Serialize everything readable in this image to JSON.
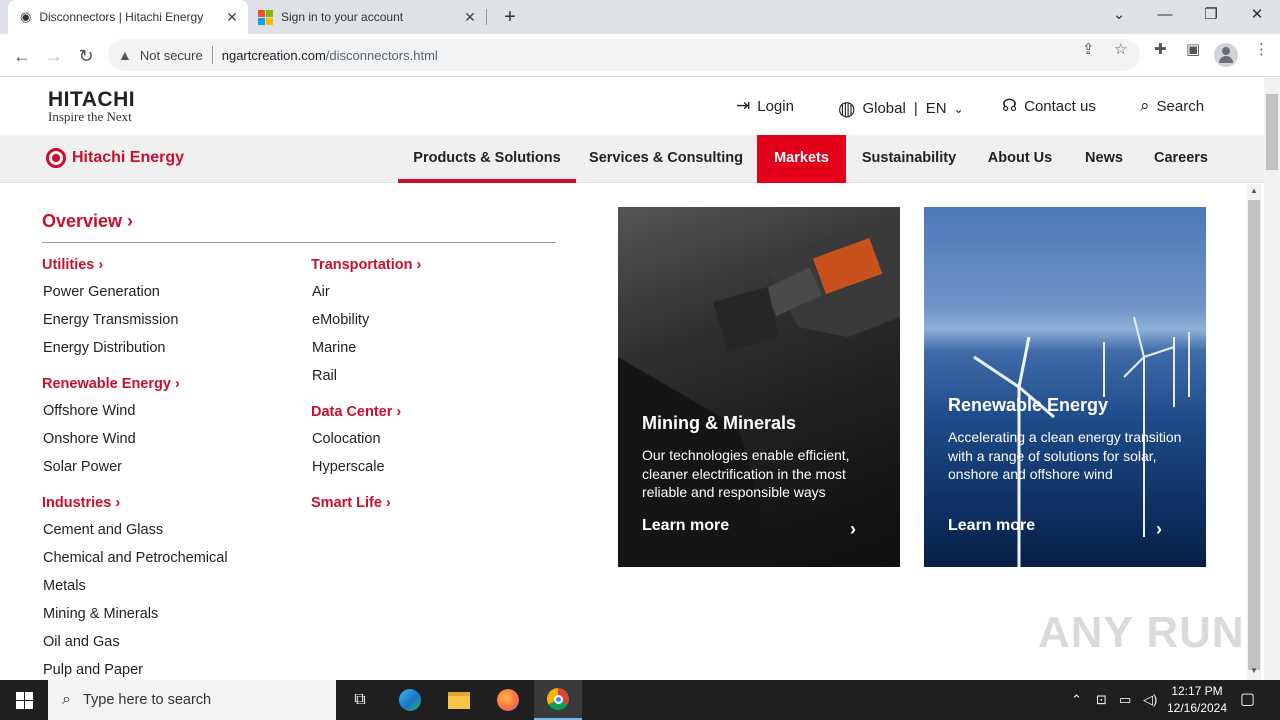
{
  "browser": {
    "tabs": [
      {
        "title": "Disconnectors | Hitachi Energy",
        "active": true
      },
      {
        "title": "Sign in to your account",
        "active": false
      }
    ],
    "security_label": "Not secure",
    "url_host": "ngartcreation.com",
    "url_path": "/disconnectors.html"
  },
  "site": {
    "brand_word": "HITACHI",
    "brand_tagline": "Inspire the Next",
    "sub_brand": "Hitachi Energy",
    "utility": {
      "login": "Login",
      "region": "Global",
      "language": "EN",
      "contact": "Contact us",
      "search": "Search"
    },
    "nav": [
      {
        "label": "Products & Solutions"
      },
      {
        "label": "Services & Consulting"
      },
      {
        "label": "Markets"
      },
      {
        "label": "Sustainability"
      },
      {
        "label": "About Us"
      },
      {
        "label": "News"
      },
      {
        "label": "Careers"
      }
    ],
    "accent_color": "#c8102e"
  },
  "menu": {
    "overview": "Overview ›",
    "columns": [
      [
        {
          "category": "Utilities ›",
          "items": [
            "Power Generation",
            "Energy Transmission",
            "Energy Distribution"
          ]
        },
        {
          "category": "Renewable Energy ›",
          "items": [
            "Offshore Wind",
            "Onshore Wind",
            "Solar Power"
          ]
        },
        {
          "category": "Industries ›",
          "items": [
            "Cement and Glass",
            "Chemical and Petrochemical",
            "Metals",
            "Mining & Minerals",
            "Oil and Gas",
            "Pulp and Paper"
          ]
        }
      ],
      [
        {
          "category": "Transportation ›",
          "items": [
            "Air",
            "eMobility",
            "Marine",
            "Rail"
          ]
        },
        {
          "category": "Data Center ›",
          "items": [
            "Colocation",
            "Hyperscale"
          ]
        },
        {
          "category": "Smart Life ›",
          "items": []
        }
      ]
    ],
    "cards": [
      {
        "title": "Mining & Minerals",
        "text": "Our technologies enable efficient, cleaner electrification in the most reliable and responsible ways",
        "link": "Learn more"
      },
      {
        "title": "Renewable Energy",
        "text": "Accelerating a clean energy transition with a range of solutions for solar, onshore and offshore wind",
        "link": "Learn more"
      }
    ]
  },
  "watermark": "ANY RUN",
  "taskbar": {
    "search_placeholder": "Type here to search",
    "time": "12:17 PM",
    "date": "12/16/2024"
  }
}
